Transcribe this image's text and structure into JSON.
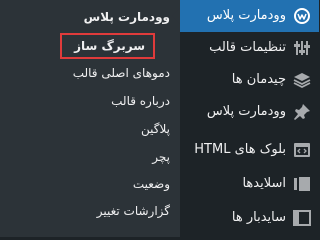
{
  "submenu": {
    "items": [
      {
        "label": "وودمارت پلاس"
      },
      {
        "label": "سربرگ ساز"
      },
      {
        "label": "دموهای اصلی قالب"
      },
      {
        "label": "درباره قالب"
      },
      {
        "label": "پلاگین"
      },
      {
        "label": "پچر"
      },
      {
        "label": "وضعیت"
      },
      {
        "label": "گزارشات تغییر"
      }
    ]
  },
  "menu": {
    "items": [
      {
        "label": "وودمارت پلاس",
        "icon": "woodmart-icon"
      },
      {
        "label": "تنظیمات قالب",
        "icon": "settings-icon"
      },
      {
        "label": "چیدمان ها",
        "icon": "layers-icon"
      },
      {
        "label": "وودمارت پلاس",
        "icon": "pin-icon"
      },
      {
        "label": "بلوک های HTML",
        "icon": "html-block-icon"
      },
      {
        "label": "اسلایدها",
        "icon": "slides-icon"
      },
      {
        "label": "سایدبار ها",
        "icon": "sidebar-icon"
      }
    ]
  },
  "colors": {
    "active": "#2271b1",
    "highlight": "#e03b3b",
    "menu_bg": "#1d2327",
    "submenu_bg": "#2c3338"
  }
}
